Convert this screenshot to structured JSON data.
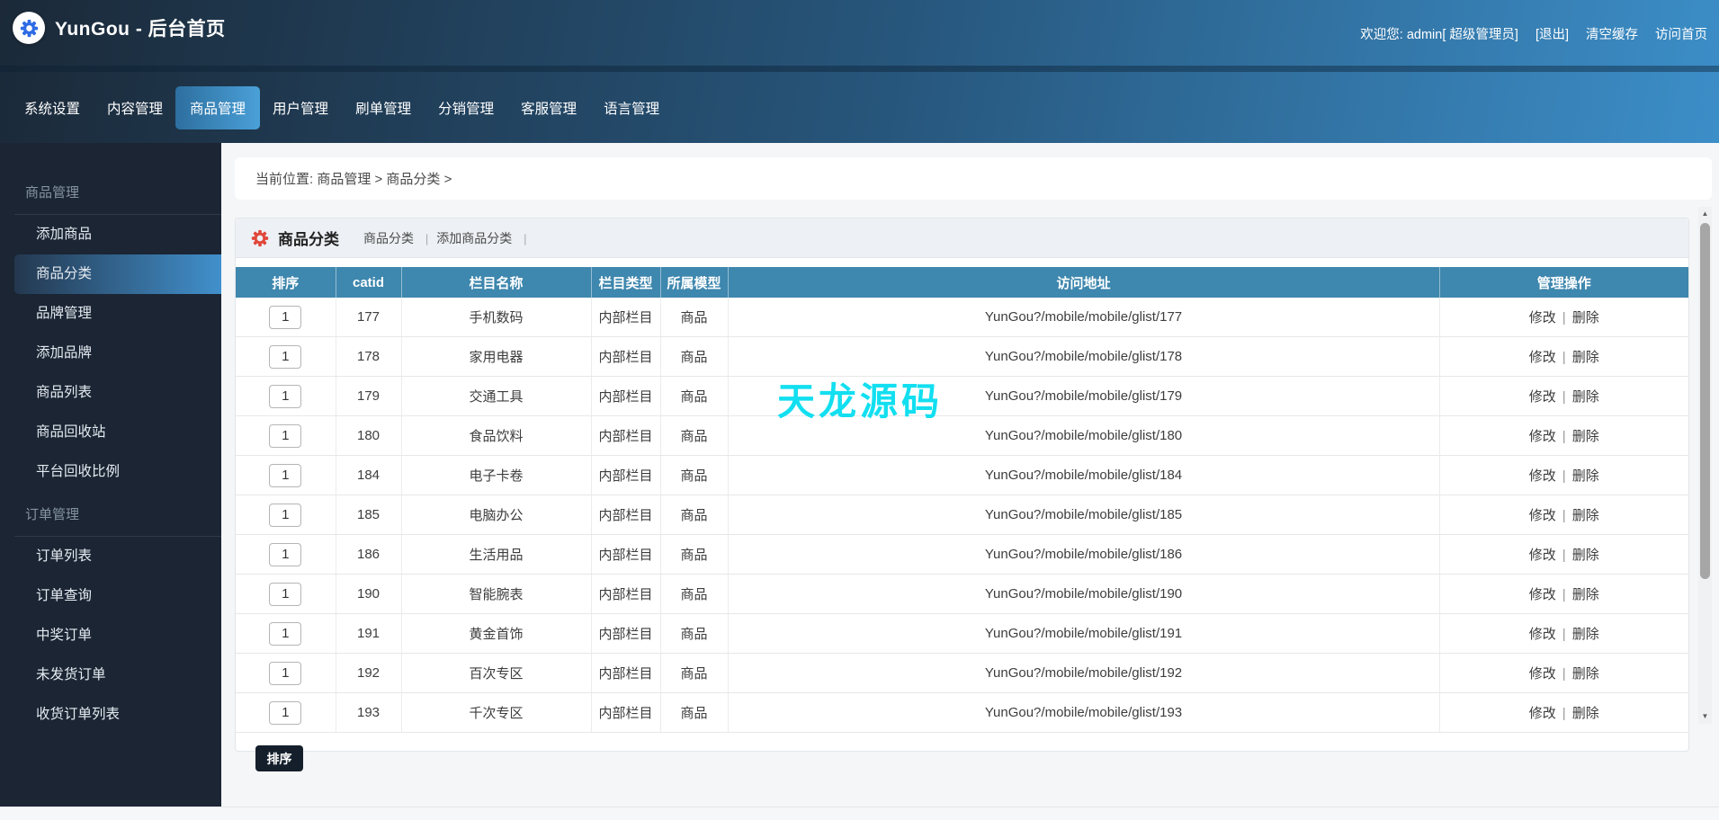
{
  "header": {
    "title": "YunGou - 后台首页",
    "welcome": "欢迎您: admin[ 超级管理员]",
    "logout": "[退出]",
    "clear_cache": "清空缓存",
    "visit_home": "访问首页"
  },
  "nav": {
    "tabs": [
      {
        "label": "系统设置"
      },
      {
        "label": "内容管理"
      },
      {
        "label": "商品管理",
        "active": true
      },
      {
        "label": "用户管理"
      },
      {
        "label": "刷单管理"
      },
      {
        "label": "分销管理"
      },
      {
        "label": "客服管理"
      },
      {
        "label": "语言管理"
      }
    ]
  },
  "sidebar": {
    "sections": [
      {
        "title": "商品管理",
        "items": [
          {
            "label": "添加商品"
          },
          {
            "label": "商品分类",
            "active": true
          },
          {
            "label": "品牌管理"
          },
          {
            "label": "添加品牌"
          },
          {
            "label": "商品列表"
          },
          {
            "label": "商品回收站"
          },
          {
            "label": "平台回收比例"
          }
        ]
      },
      {
        "title": "订单管理",
        "items": [
          {
            "label": "订单列表"
          },
          {
            "label": "订单查询"
          },
          {
            "label": "中奖订单"
          },
          {
            "label": "未发货订单"
          },
          {
            "label": "收货订单列表"
          }
        ]
      }
    ]
  },
  "breadcrumb": {
    "text": "当前位置: 商品管理 > 商品分类 >"
  },
  "panel": {
    "title": "商品分类",
    "links": [
      {
        "label": "商品分类"
      },
      {
        "label": "添加商品分类"
      }
    ],
    "separator": "|"
  },
  "table": {
    "columns": [
      "排序",
      "catid",
      "栏目名称",
      "栏目类型",
      "所属模型",
      "访问地址",
      "管理操作"
    ],
    "actions": {
      "edit": "修改",
      "del": "删除",
      "sep": "|"
    },
    "rows": [
      {
        "sort": "1",
        "catid": "177",
        "name": "手机数码",
        "type": "内部栏目",
        "model": "商品",
        "url": "YunGou?/mobile/mobile/glist/177"
      },
      {
        "sort": "1",
        "catid": "178",
        "name": "家用电器",
        "type": "内部栏目",
        "model": "商品",
        "url": "YunGou?/mobile/mobile/glist/178"
      },
      {
        "sort": "1",
        "catid": "179",
        "name": "交通工具",
        "type": "内部栏目",
        "model": "商品",
        "url": "YunGou?/mobile/mobile/glist/179"
      },
      {
        "sort": "1",
        "catid": "180",
        "name": "食品饮料",
        "type": "内部栏目",
        "model": "商品",
        "url": "YunGou?/mobile/mobile/glist/180"
      },
      {
        "sort": "1",
        "catid": "184",
        "name": "电子卡卷",
        "type": "内部栏目",
        "model": "商品",
        "url": "YunGou?/mobile/mobile/glist/184"
      },
      {
        "sort": "1",
        "catid": "185",
        "name": "电脑办公",
        "type": "内部栏目",
        "model": "商品",
        "url": "YunGou?/mobile/mobile/glist/185"
      },
      {
        "sort": "1",
        "catid": "186",
        "name": "生活用品",
        "type": "内部栏目",
        "model": "商品",
        "url": "YunGou?/mobile/mobile/glist/186"
      },
      {
        "sort": "1",
        "catid": "190",
        "name": "智能腕表",
        "type": "内部栏目",
        "model": "商品",
        "url": "YunGou?/mobile/mobile/glist/190"
      },
      {
        "sort": "1",
        "catid": "191",
        "name": "黄金首饰",
        "type": "内部栏目",
        "model": "商品",
        "url": "YunGou?/mobile/mobile/glist/191"
      },
      {
        "sort": "1",
        "catid": "192",
        "name": "百次专区",
        "type": "内部栏目",
        "model": "商品",
        "url": "YunGou?/mobile/mobile/glist/192"
      },
      {
        "sort": "1",
        "catid": "193",
        "name": "千次专区",
        "type": "内部栏目",
        "model": "商品",
        "url": "YunGou?/mobile/mobile/glist/193"
      }
    ]
  },
  "sort_button": "排序",
  "watermark": "天龙源码",
  "scrollbar": {
    "up": "▲",
    "down": "▼"
  },
  "colors": {
    "topbar_gradient_start": "#1b2938",
    "topbar_gradient_end": "#3c8ec8",
    "nav_active": "#4aa0d8",
    "sidebar_bg": "#1b2534",
    "sidebar_active": "#4190cc",
    "table_header_bg": "#3e87ae",
    "panel_gear": "#e0473b",
    "logo_gear": "#2e6be5",
    "watermark": "#12dff0",
    "sort_button_bg": "#141f2b"
  }
}
